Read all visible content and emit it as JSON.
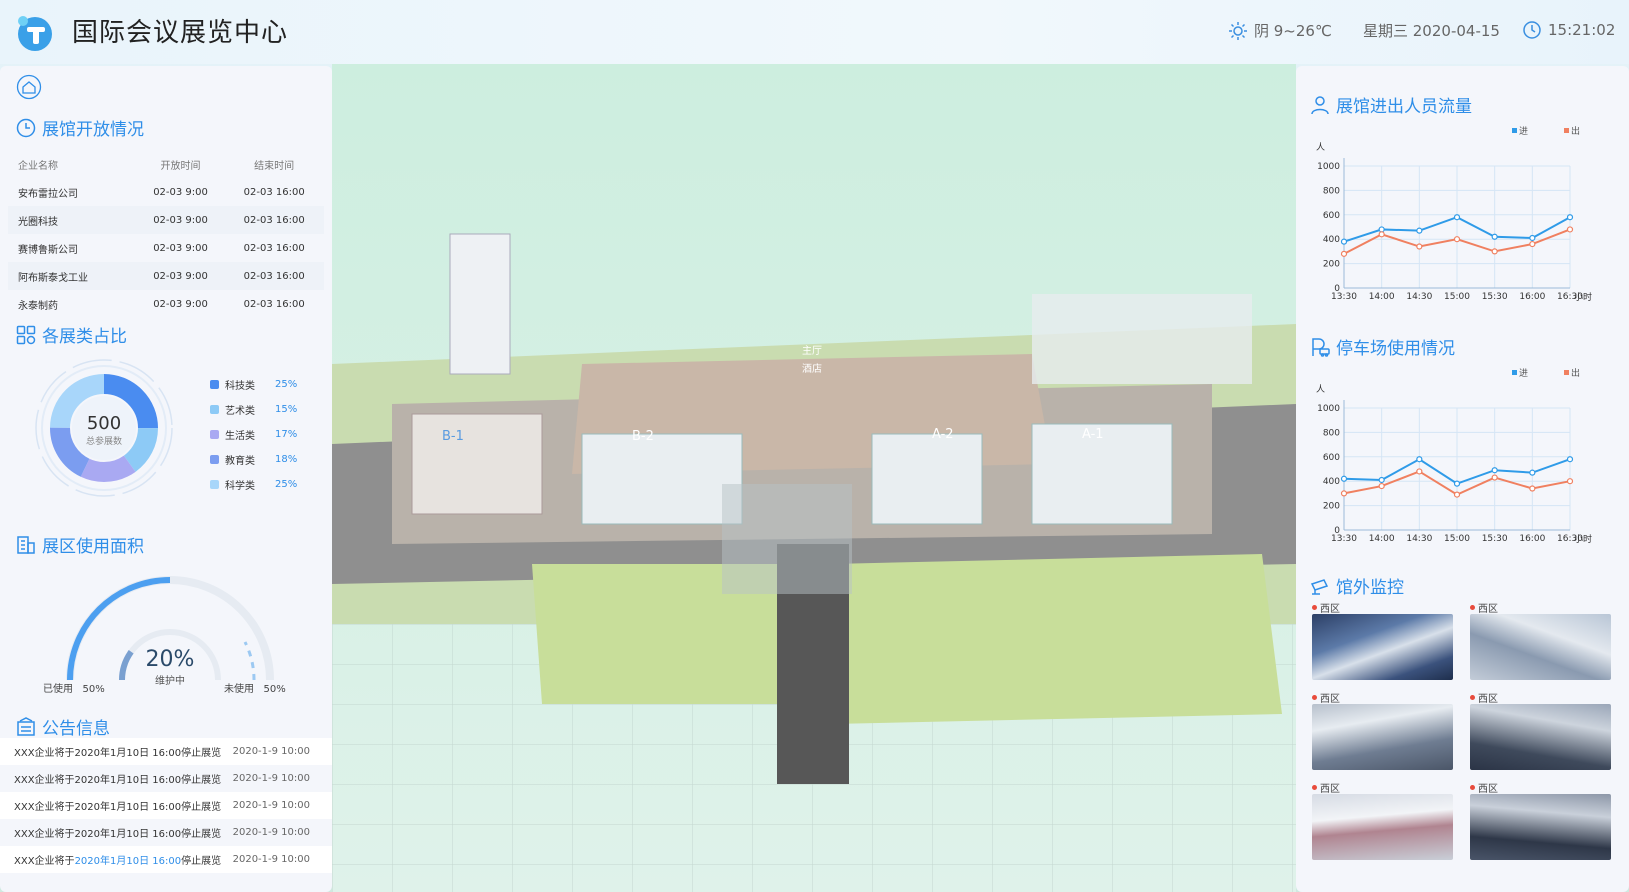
{
  "app": {
    "title": "国际会议展览中心"
  },
  "header": {
    "weather": "阴 9~26℃",
    "date": "星期三 2020-04-15",
    "time": "15:21:02"
  },
  "colors": {
    "accent": "#2f8ee8",
    "in": "#2f9be8",
    "out": "#f08060"
  },
  "left": {
    "open_title": "展馆开放情况",
    "table": {
      "headers": [
        "企业名称",
        "开放时间",
        "结束时间"
      ],
      "rows": [
        [
          "安布雷拉公司",
          "02-03 9:00",
          "02-03 16:00"
        ],
        [
          "光圈科技",
          "02-03 9:00",
          "02-03 16:00"
        ],
        [
          "赛博鲁斯公司",
          "02-03 9:00",
          "02-03 16:00"
        ],
        [
          "阿布斯泰戈工业",
          "02-03 9:00",
          "02-03 16:00"
        ],
        [
          "永泰制药",
          "02-03 9:00",
          "02-03 16:00"
        ]
      ]
    },
    "category_title": "各展类占比",
    "donut": {
      "value": "500",
      "label": "总参展数"
    },
    "categories": [
      {
        "name": "科技类",
        "value": "25%",
        "pct": 25,
        "color": "#4a8cf0"
      },
      {
        "name": "艺术类",
        "value": "15%",
        "pct": 15,
        "color": "#8dcaf6"
      },
      {
        "name": "生活类",
        "value": "17%",
        "pct": 17,
        "color": "#a9a9f2"
      },
      {
        "name": "教育类",
        "value": "18%",
        "pct": 18,
        "color": "#7b9df0"
      },
      {
        "name": "科学类",
        "value": "25%",
        "pct": 25,
        "color": "#a8d6fa"
      }
    ],
    "area_title": "展区使用面积",
    "gauge": {
      "value": "20%",
      "label": "维护中",
      "used_label": "已使用",
      "used_value": "50%",
      "free_label": "未使用",
      "free_value": "50%",
      "used_fraction": 0.5,
      "maint_fraction": 0.2
    },
    "notice_title": "公告信息",
    "notices": [
      {
        "text": "XXX企业将于2020年1月10日 16:00停止展览",
        "date": "2020-1-9 10:00"
      },
      {
        "text": "XXX企业将于2020年1月10日 16:00停止展览",
        "date": "2020-1-9 10:00"
      },
      {
        "text": "XXX企业将于2020年1月10日 16:00停止展览",
        "date": "2020-1-9 10:00"
      },
      {
        "text": "XXX企业将于2020年1月10日 16:00停止展览",
        "date": "2020-1-9 10:00"
      },
      {
        "text_prefix": "XXX企业将于",
        "text_highlight": "2020年1月10日 16:00",
        "text_suffix": "停止展览",
        "date": "2020-1-9 10:00"
      }
    ]
  },
  "scene": {
    "labels": [
      "B-1",
      "B-2",
      "A-2",
      "A-1",
      "主厅",
      "酒店"
    ]
  },
  "chart_data": [
    {
      "type": "line",
      "title": "展馆进出人员流量",
      "ylabel": "人",
      "xlabel": "小时",
      "x": [
        "13:30",
        "14:00",
        "14:30",
        "15:00",
        "15:30",
        "16:00",
        "16:30"
      ],
      "ylim": [
        0,
        1000
      ],
      "yticks": [
        0,
        200,
        400,
        600,
        800,
        1000
      ],
      "legend": "top-right",
      "series": [
        {
          "name": "进",
          "values": [
            380,
            480,
            470,
            580,
            420,
            410,
            580
          ]
        },
        {
          "name": "出",
          "values": [
            280,
            440,
            340,
            400,
            300,
            360,
            480
          ]
        }
      ]
    },
    {
      "type": "line",
      "title": "停车场使用情况",
      "ylabel": "人",
      "xlabel": "小时",
      "x": [
        "13:30",
        "14:00",
        "14:30",
        "15:00",
        "15:30",
        "16:00",
        "16:30"
      ],
      "ylim": [
        0,
        1000
      ],
      "yticks": [
        0,
        200,
        400,
        600,
        800,
        1000
      ],
      "legend": "top-right",
      "series": [
        {
          "name": "进",
          "values": [
            420,
            410,
            580,
            380,
            490,
            470,
            580
          ]
        },
        {
          "name": "出",
          "values": [
            300,
            360,
            480,
            290,
            430,
            340,
            400
          ]
        }
      ]
    }
  ],
  "monitor": {
    "title": "馆外监控",
    "cams": [
      "西区",
      "西区",
      "西区",
      "西区",
      "西区",
      "西区"
    ]
  }
}
